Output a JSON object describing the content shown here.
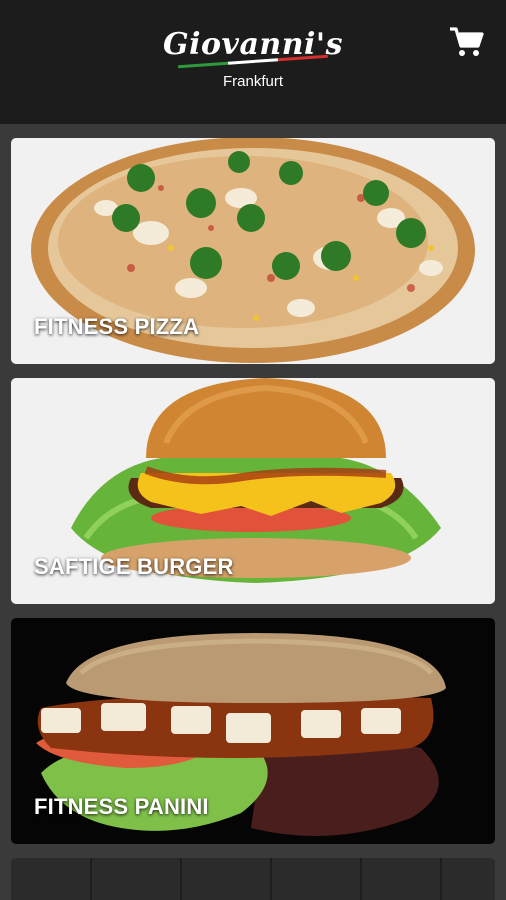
{
  "header": {
    "logo_text": "Giovanni's",
    "city": "Frankfurt",
    "cart_icon": "cart-icon",
    "flag_colors": [
      "#2e9a3c",
      "#ffffff",
      "#d32f2f"
    ]
  },
  "categories": [
    {
      "label": "FITNESS PIZZA",
      "image": "pizza"
    },
    {
      "label": "SAFTIGE BURGER",
      "image": "burger"
    },
    {
      "label": "FITNESS PANINI",
      "image": "panini"
    }
  ],
  "colors": {
    "header_bg": "#1c1c1c",
    "page_bg": "#3a3a3a"
  }
}
